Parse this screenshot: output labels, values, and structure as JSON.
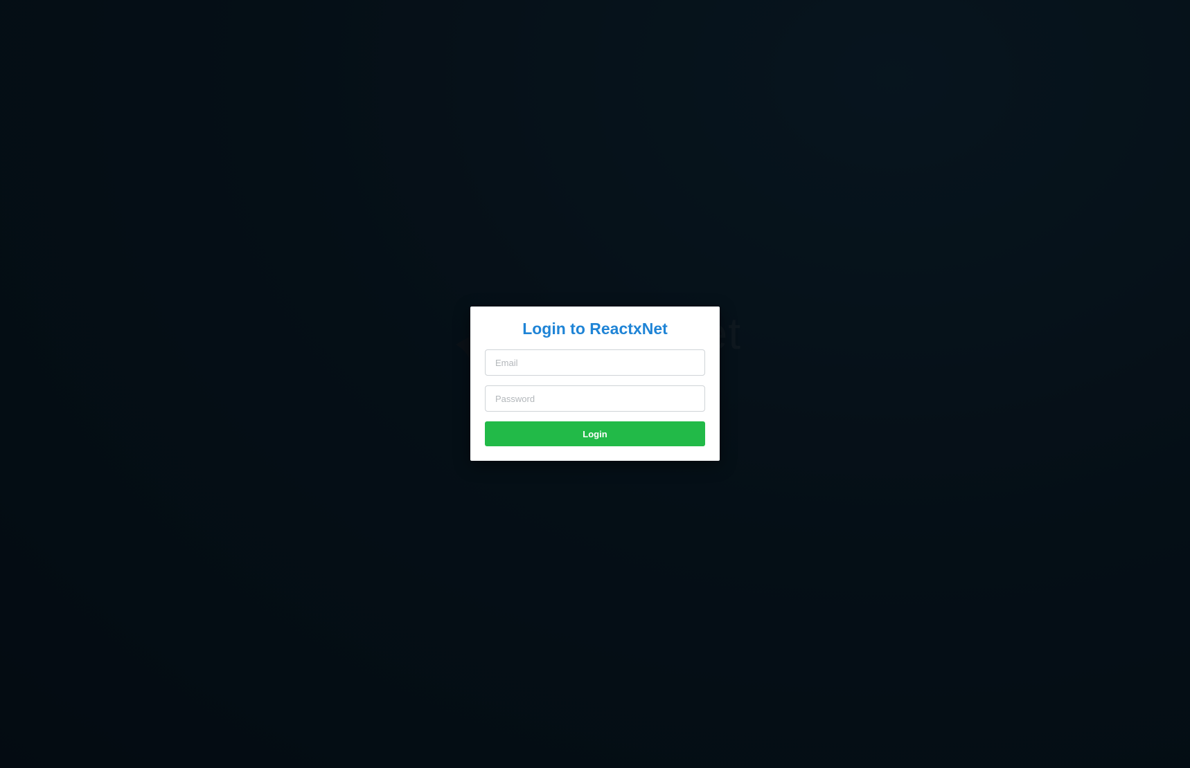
{
  "background": {
    "logo_text": "ReactxNet",
    "colors": {
      "page": "#081822",
      "logo": "#1e2a33"
    }
  },
  "login_modal": {
    "title": "Login to ReactxNet",
    "email_placeholder": "Email",
    "email_value": "",
    "password_placeholder": "Password",
    "password_value": "",
    "submit_label": "Login",
    "colors": {
      "title": "#1f84d6",
      "button": "#22ba48",
      "button_text": "#ffffff"
    }
  }
}
